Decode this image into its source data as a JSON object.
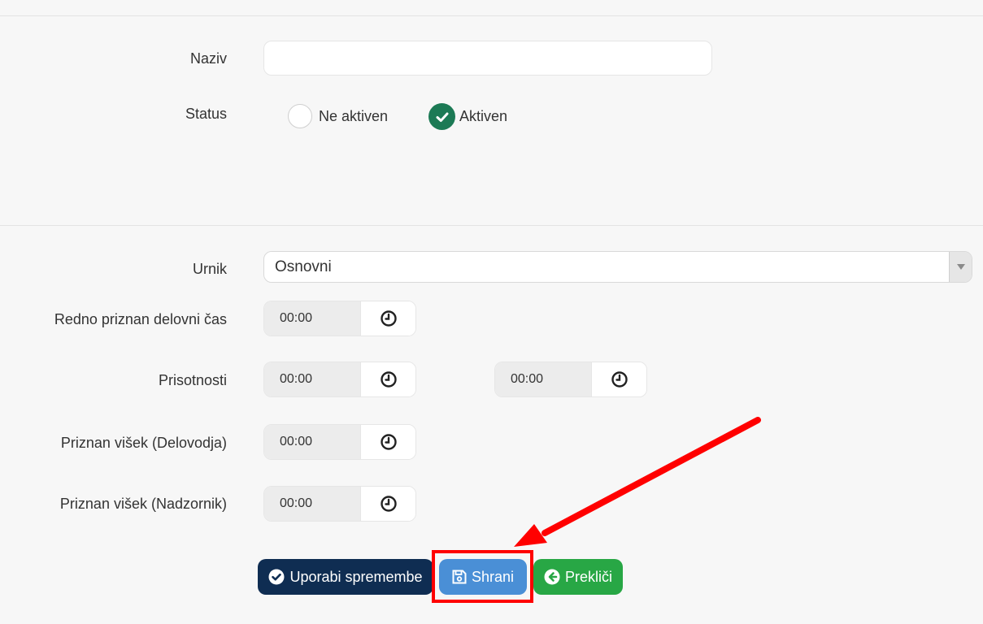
{
  "form": {
    "naziv_label": "Naziv",
    "naziv_value": "",
    "status_label": "Status",
    "status_options": [
      "Ne aktiven",
      "Aktiven"
    ],
    "status_selected": "Aktiven",
    "urnik_label": "Urnik",
    "urnik_value": "Osnovni",
    "redno_label": "Redno priznan delovni čas",
    "redno_value": "00:00",
    "prisotnosti_label": "Prisotnosti",
    "prisotnosti_from": "00:00",
    "prisotnosti_to": "00:00",
    "visek_delovodja_label": "Priznan višek (Delovodja)",
    "visek_delovodja_value": "00:00",
    "visek_nadzornik_label": "Priznan višek (Nadzornik)",
    "visek_nadzornik_value": "00:00"
  },
  "actions": {
    "apply_label": "Uporabi spremembe",
    "save_label": "Shrani",
    "cancel_label": "Prekliči"
  },
  "colors": {
    "apply": "#0f2d52",
    "save": "#4a8fd6",
    "cancel": "#28a745",
    "radio_checked": "#1c7a55",
    "annotation": "#ff0000"
  },
  "icons": {
    "time_picker": "clock-icon",
    "apply": "check-circle-icon",
    "save": "floppy-disk-icon",
    "cancel": "arrow-circle-left-icon",
    "select": "caret-down-icon"
  }
}
